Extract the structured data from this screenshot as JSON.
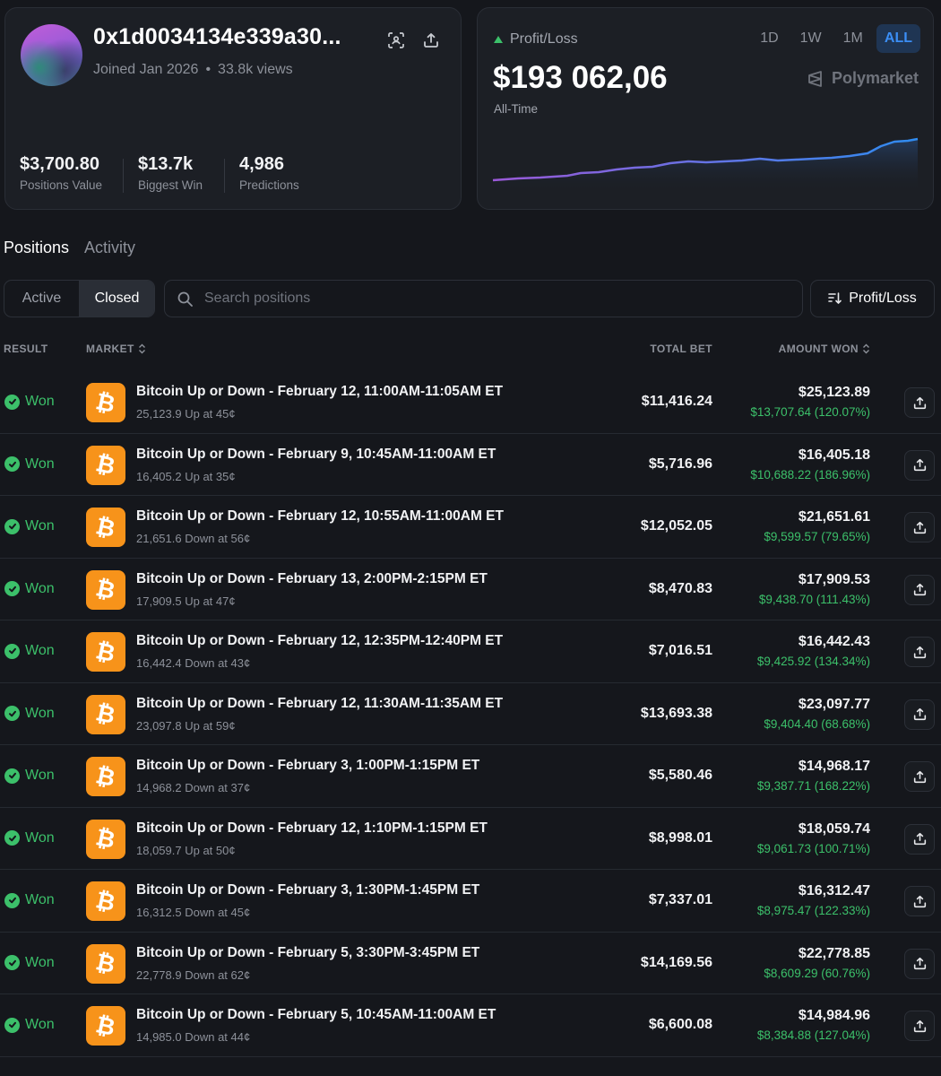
{
  "profile": {
    "wallet": "0x1d0034134e339a30...",
    "joined": "Joined Jan 2026",
    "views": "33.8k views",
    "stats": [
      {
        "value": "$3,700.80",
        "label": "Positions Value"
      },
      {
        "value": "$13.7k",
        "label": "Biggest Win"
      },
      {
        "value": "4,986",
        "label": "Predictions"
      }
    ]
  },
  "pnl": {
    "label": "Profit/Loss",
    "value": "$193 062,06",
    "period": "All-Time",
    "brand": "Polymarket",
    "ranges": [
      "1D",
      "1W",
      "1M",
      "ALL"
    ],
    "active_range": "ALL",
    "colors": {
      "line_start": "#9b59d8",
      "line_end": "#2f8cf0",
      "up": "#3cc06a"
    }
  },
  "tabs": [
    "Positions",
    "Activity"
  ],
  "filters": {
    "segments": [
      "Active",
      "Closed"
    ],
    "active_segment": "Closed",
    "search_placeholder": "Search positions",
    "sort_label": "Profit/Loss"
  },
  "table": {
    "headers": {
      "result": "RESULT",
      "market": "MARKET",
      "total_bet": "TOTAL BET",
      "amount_won": "AMOUNT WON"
    },
    "rows": [
      {
        "result": "Won",
        "title": "Bitcoin Up or Down - February 12, 11:00AM-11:05AM ET",
        "sub": "25,123.9 Up at 45¢",
        "bet": "$11,416.24",
        "won": "$25,123.89",
        "pl": "$13,707.64 (120.07%)"
      },
      {
        "result": "Won",
        "title": "Bitcoin Up or Down - February 9, 10:45AM-11:00AM ET",
        "sub": "16,405.2 Up at 35¢",
        "bet": "$5,716.96",
        "won": "$16,405.18",
        "pl": "$10,688.22 (186.96%)"
      },
      {
        "result": "Won",
        "title": "Bitcoin Up or Down - February 12, 10:55AM-11:00AM ET",
        "sub": "21,651.6 Down at 56¢",
        "bet": "$12,052.05",
        "won": "$21,651.61",
        "pl": "$9,599.57 (79.65%)"
      },
      {
        "result": "Won",
        "title": "Bitcoin Up or Down - February 13, 2:00PM-2:15PM ET",
        "sub": "17,909.5 Up at 47¢",
        "bet": "$8,470.83",
        "won": "$17,909.53",
        "pl": "$9,438.70 (111.43%)"
      },
      {
        "result": "Won",
        "title": "Bitcoin Up or Down - February 12, 12:35PM-12:40PM ET",
        "sub": "16,442.4 Down at 43¢",
        "bet": "$7,016.51",
        "won": "$16,442.43",
        "pl": "$9,425.92 (134.34%)"
      },
      {
        "result": "Won",
        "title": "Bitcoin Up or Down - February 12, 11:30AM-11:35AM ET",
        "sub": "23,097.8 Up at 59¢",
        "bet": "$13,693.38",
        "won": "$23,097.77",
        "pl": "$9,404.40 (68.68%)"
      },
      {
        "result": "Won",
        "title": "Bitcoin Up or Down - February 3, 1:00PM-1:15PM ET",
        "sub": "14,968.2 Down at 37¢",
        "bet": "$5,580.46",
        "won": "$14,968.17",
        "pl": "$9,387.71 (168.22%)"
      },
      {
        "result": "Won",
        "title": "Bitcoin Up or Down - February 12, 1:10PM-1:15PM ET",
        "sub": "18,059.7 Up at 50¢",
        "bet": "$8,998.01",
        "won": "$18,059.74",
        "pl": "$9,061.73 (100.71%)"
      },
      {
        "result": "Won",
        "title": "Bitcoin Up or Down - February 3, 1:30PM-1:45PM ET",
        "sub": "16,312.5 Down at 45¢",
        "bet": "$7,337.01",
        "won": "$16,312.47",
        "pl": "$8,975.47 (122.33%)"
      },
      {
        "result": "Won",
        "title": "Bitcoin Up or Down - February 5, 3:30PM-3:45PM ET",
        "sub": "22,778.9 Down at 62¢",
        "bet": "$14,169.56",
        "won": "$22,778.85",
        "pl": "$8,609.29 (60.76%)"
      },
      {
        "result": "Won",
        "title": "Bitcoin Up or Down - February 5, 10:45AM-11:00AM ET",
        "sub": "14,985.0 Down at 44¢",
        "bet": "$6,600.08",
        "won": "$14,984.96",
        "pl": "$8,384.88 (127.04%)"
      }
    ]
  }
}
